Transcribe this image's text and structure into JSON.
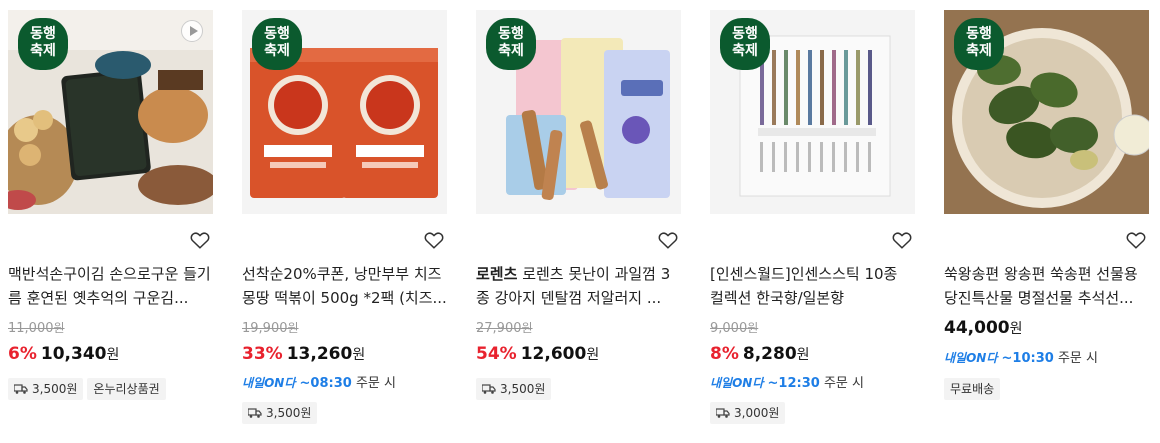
{
  "products": [
    {
      "badge": [
        "동행",
        "축제"
      ],
      "has_video": true,
      "title": "맥반석손구이김 손으로구운 들기름 훈연된 옛추억의 구운김...",
      "original_price": "11,000",
      "discount": "6%",
      "price": "10,340",
      "currency": "원",
      "tags": [
        "3,500원",
        "온누리상품권"
      ]
    },
    {
      "badge": [
        "동행",
        "축제"
      ],
      "has_video": false,
      "title": "선착순20%쿠폰, 낭만부부 치즈몽땅 떡볶이 500g *2팩 (치즈...",
      "original_price": "19,900",
      "discount": "33%",
      "price": "13,260",
      "currency": "원",
      "next_day": {
        "logo": "내일ON다",
        "time": "~08:30",
        "suffix": "주문 시"
      },
      "tags": [
        "3,500원"
      ]
    },
    {
      "badge": [
        "동행",
        "축제"
      ],
      "has_video": false,
      "brand": "로렌츠",
      "title": "로렌츠 못난이 과일껌 3종 강아지 덴탈껌 저알러지 ...",
      "original_price": "27,900",
      "discount": "54%",
      "price": "12,600",
      "currency": "원",
      "tags": [
        "3,500원"
      ]
    },
    {
      "badge": [
        "동행",
        "축제"
      ],
      "has_video": false,
      "title": "[인센스월드]인센스스틱 10종 컬렉션 한국향/일본향",
      "original_price": "9,000",
      "discount": "8%",
      "price": "8,280",
      "currency": "원",
      "next_day": {
        "logo": "내일ON다",
        "time": "~12:30",
        "suffix": "주문 시"
      },
      "tags": [
        "3,000원"
      ]
    },
    {
      "badge": [
        "동행",
        "축제"
      ],
      "has_video": false,
      "title": "쑥왕송편 왕송편 쑥송편 선물용 당진특산물 명절선물 추석선...",
      "price": "44,000",
      "currency": "원",
      "next_day": {
        "logo": "내일ON다",
        "time": "~10:30",
        "suffix": "주문 시"
      },
      "tags": [
        "무료배송"
      ]
    }
  ],
  "colors": {
    "discount": "#e8222e",
    "badge_bg": "#0b5a2e",
    "next_day": "#1e7ee6"
  }
}
